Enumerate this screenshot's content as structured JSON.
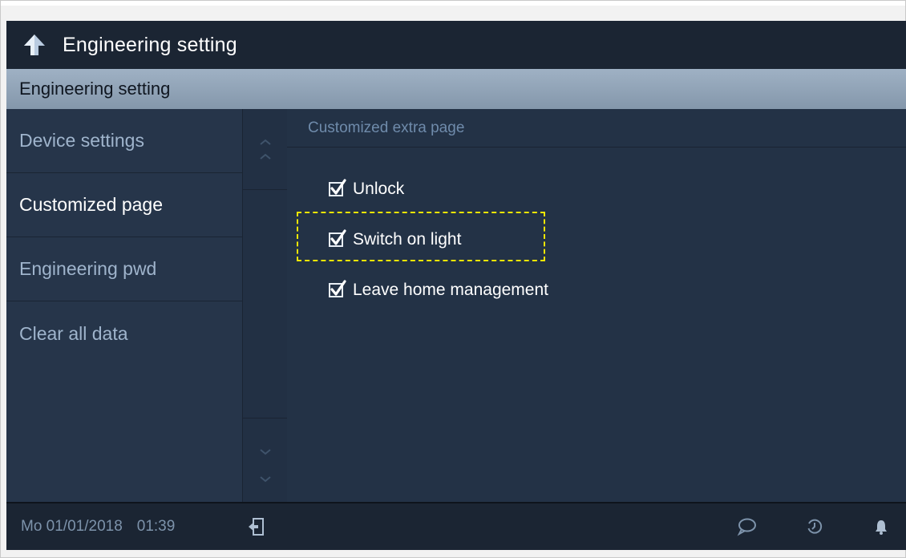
{
  "header": {
    "title": "Engineering setting"
  },
  "section": {
    "title": "Engineering setting"
  },
  "sidebar": {
    "items": [
      {
        "label": "Device settings",
        "active": false
      },
      {
        "label": "Customized page",
        "active": true
      },
      {
        "label": "Engineering pwd",
        "active": false
      },
      {
        "label": "Clear all data",
        "active": false
      }
    ]
  },
  "content": {
    "header": "Customized extra page",
    "options": [
      {
        "label": "Unlock",
        "checked": true
      },
      {
        "label": "Switch on light",
        "checked": true
      },
      {
        "label": "Leave home management",
        "checked": true
      }
    ]
  },
  "status": {
    "date": "Mo 01/01/2018",
    "time": "01:39"
  },
  "icons": {
    "back": "back-arrow-icon",
    "exit": "exit-door-icon",
    "message": "message-bubble-icon",
    "history": "history-clock-icon",
    "bell": "bell-icon",
    "scroll_up": "chevron-up-icon",
    "scroll_down": "chevron-down-icon"
  },
  "colors": {
    "highlight": "#f2e600",
    "active_text": "#ffffff",
    "inactive_text": "#9fb4cc"
  }
}
